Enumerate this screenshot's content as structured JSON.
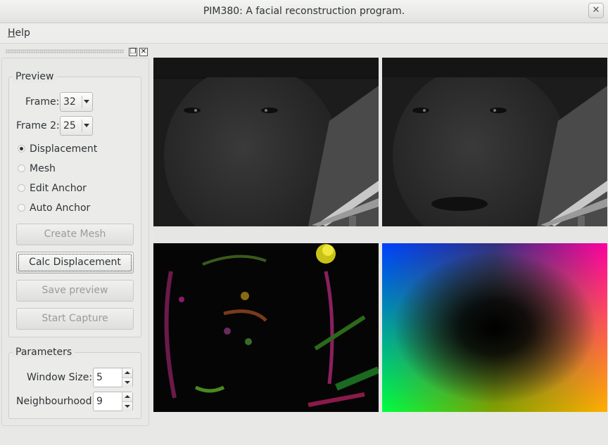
{
  "window": {
    "title": "PIM380: A facial reconstruction program.",
    "close_glyph": "✕"
  },
  "menu": {
    "help_accel": "H",
    "help_rest": "elp"
  },
  "dock": {
    "float_glyph": "❐",
    "close_glyph": "✕"
  },
  "preview": {
    "title": "Preview",
    "frame_label": "Frame:",
    "frame_value": "32",
    "frame2_label": "Frame 2:",
    "frame2_value": "25",
    "modes": [
      {
        "label": "Displacement",
        "selected": true
      },
      {
        "label": "Mesh",
        "selected": false
      },
      {
        "label": "Edit Anchor",
        "selected": false
      },
      {
        "label": "Auto Anchor",
        "selected": false
      }
    ],
    "buttons": {
      "create_mesh": "Create Mesh",
      "calc_displacement": "Calc Displacement",
      "save_preview": "Save preview",
      "start_capture": "Start Capture"
    }
  },
  "parameters": {
    "title": "Parameters",
    "window_size_label": "Window Size:",
    "window_size_value": "5",
    "neighbourhood_label": "Neighbourhood:",
    "neighbourhood_value": "9"
  },
  "colors": {
    "flow_black": "#050505",
    "face_dark": "#2a2a2a"
  }
}
